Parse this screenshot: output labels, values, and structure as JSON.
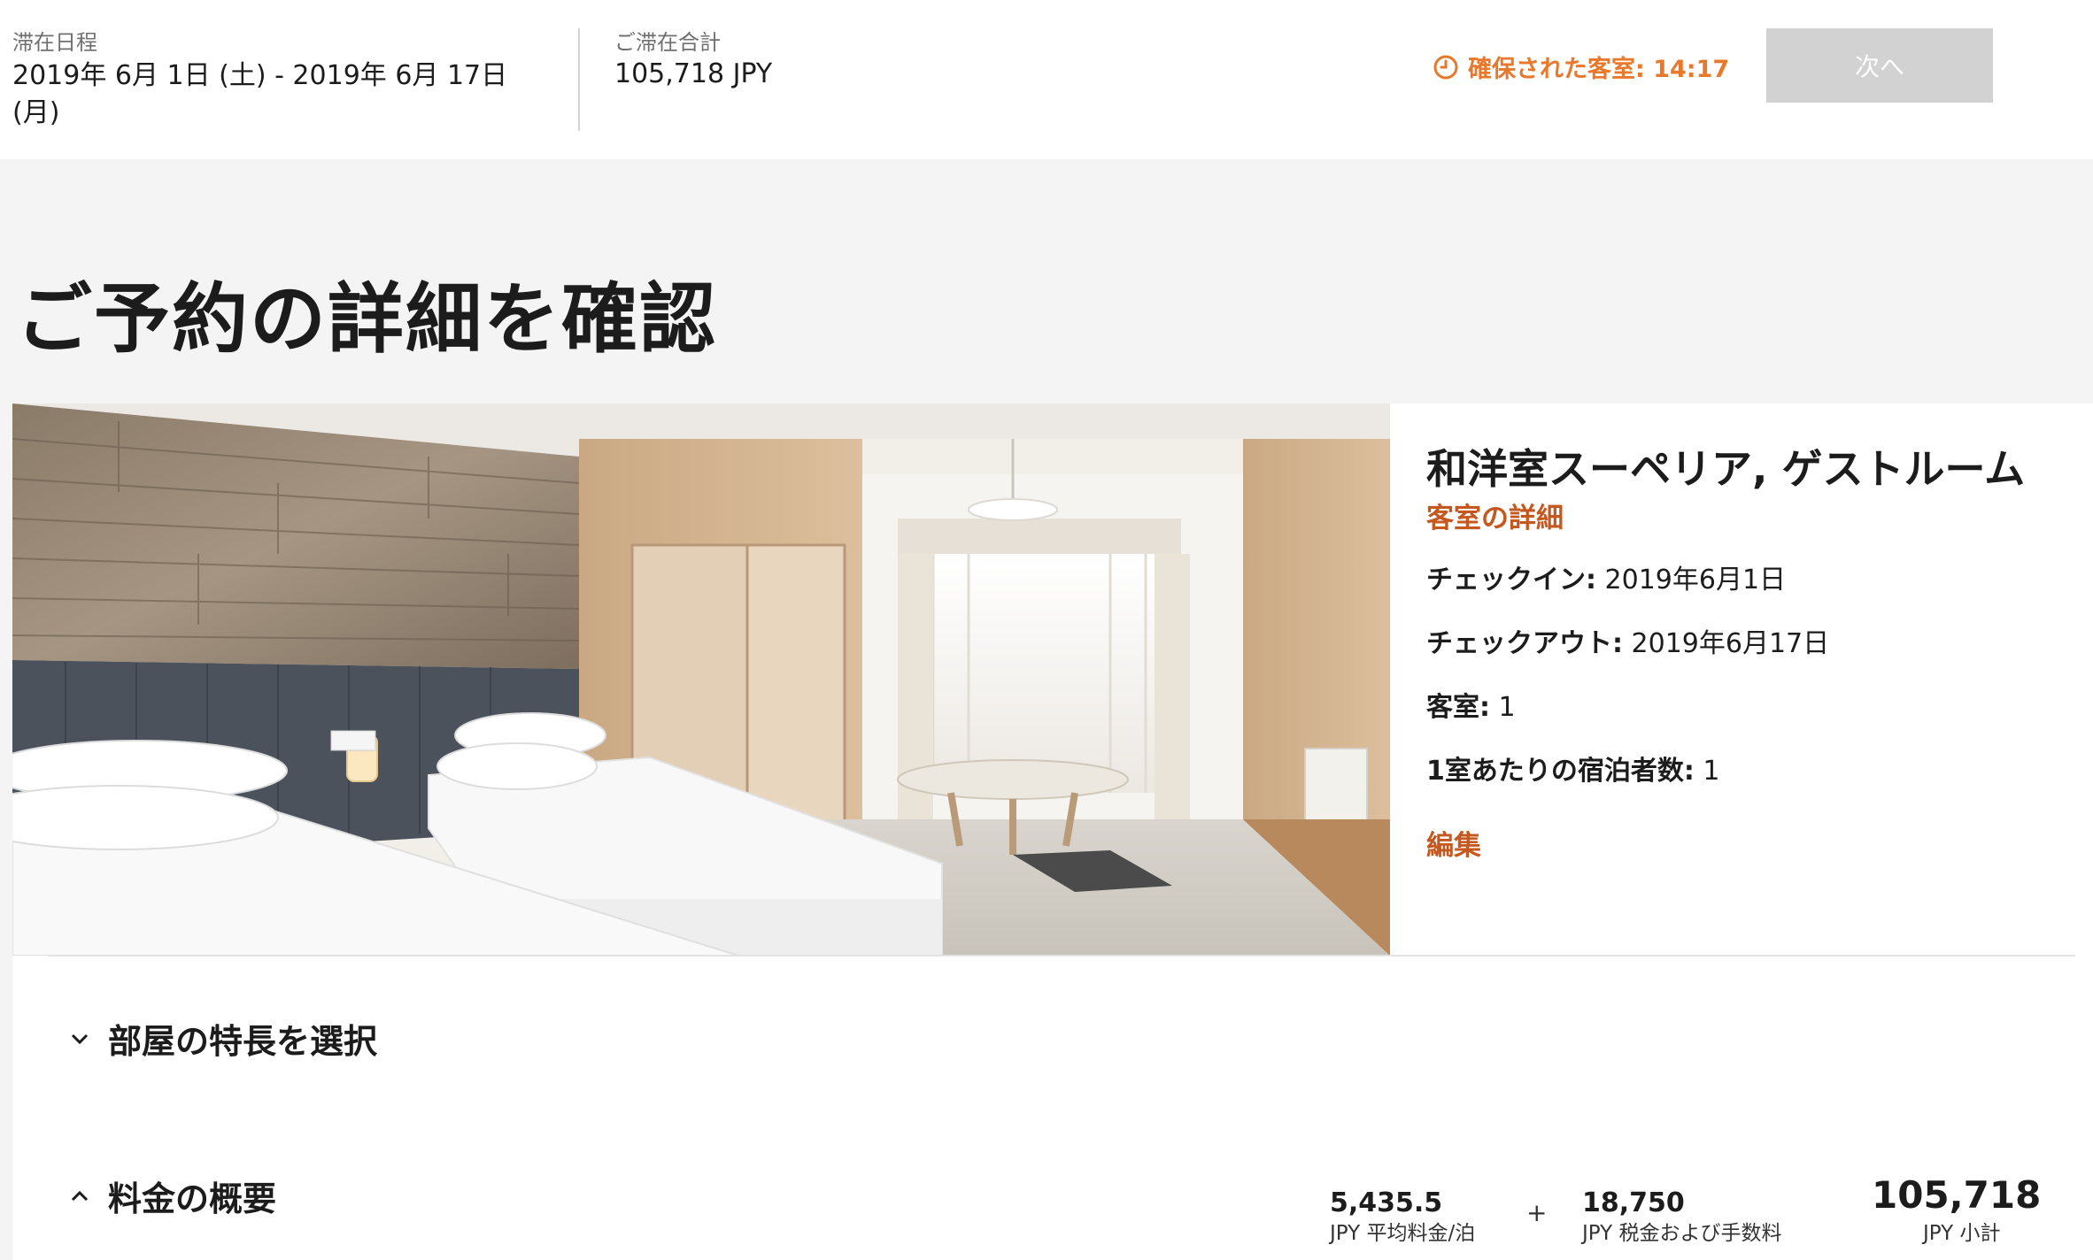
{
  "header": {
    "stay_label": "滞在日程",
    "stay_dates_line1": "2019年 6月 1日 (土) - 2019年 6月 17日",
    "stay_dates_line2": "(月)",
    "total_label": "ご滞在合計",
    "total_value": "105,718 JPY",
    "timer_text": "確保された客室: 14:17",
    "next_button": "次へ"
  },
  "page_title": "ご予約の詳細を確認",
  "room": {
    "name": "和洋室スーペリア, ゲストルーム",
    "details_link": "客室の詳細",
    "checkin_label": "チェックイン:",
    "checkin_value": " 2019年6月1日",
    "checkout_label": "チェックアウト:",
    "checkout_value": " 2019年6月17日",
    "rooms_label": "客室:",
    "rooms_value": " 1",
    "guests_label": "1室あたりの宿泊者数:",
    "guests_value": " 1",
    "edit_link": "編集"
  },
  "sections": {
    "features": "部屋の特長を選択",
    "summary": "料金の概要"
  },
  "summary": {
    "avg_rate_value": "5,435.5",
    "avg_rate_label": "JPY 平均料金/泊",
    "plus": "+",
    "tax_value": "18,750",
    "tax_label": "JPY 税金および手数料",
    "subtotal_value": "105,718",
    "subtotal_label": "JPY 小計"
  },
  "colors": {
    "accent_orange": "#c4581f",
    "timer_orange": "#e8792c",
    "disabled_button": "#d2d2d2"
  },
  "icons": [
    "clock-icon",
    "chevron-down-icon",
    "chevron-up-icon"
  ]
}
